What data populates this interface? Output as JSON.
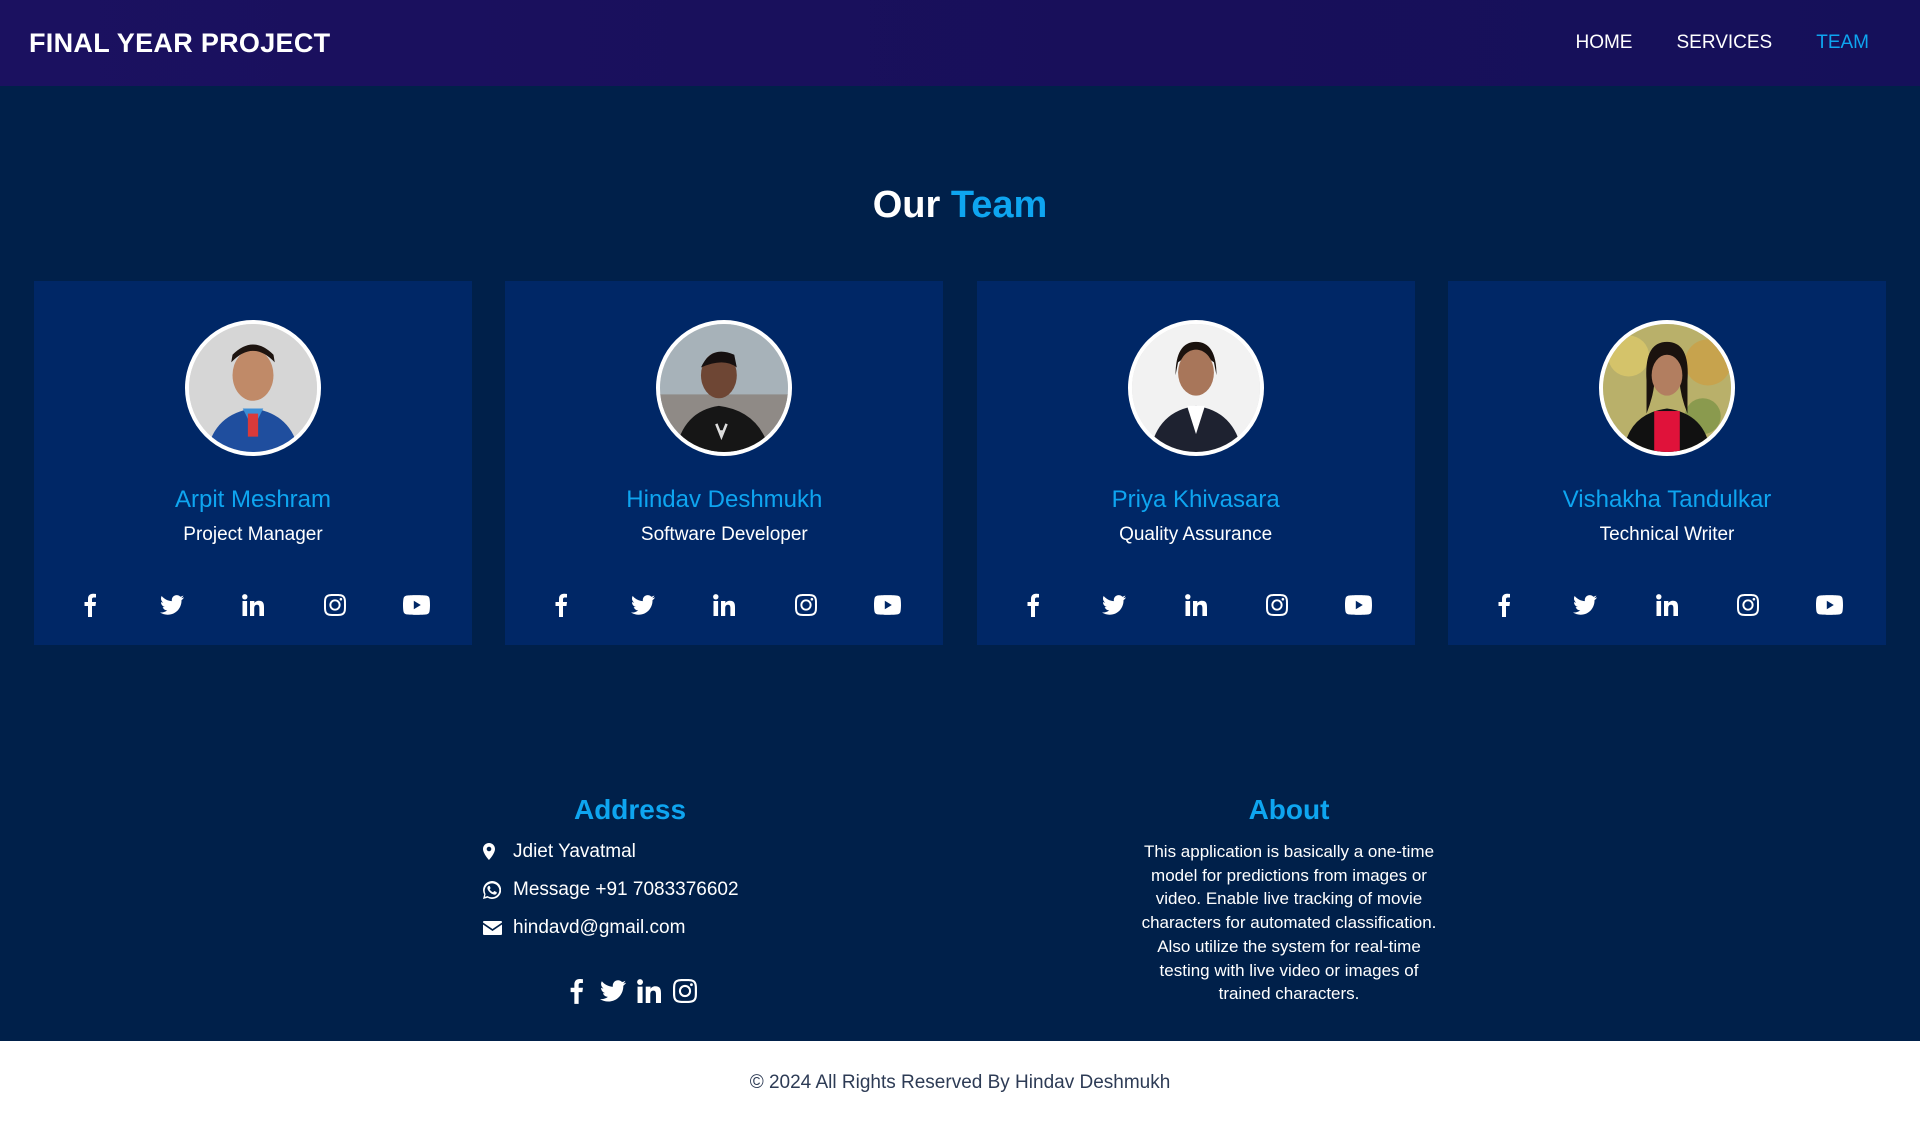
{
  "header": {
    "brand": "FINAL YEAR PROJECT",
    "nav": [
      {
        "label": "HOME"
      },
      {
        "label": "SERVICES"
      },
      {
        "label": "TEAM",
        "active": true
      }
    ]
  },
  "team": {
    "title_prefix": "Our",
    "title_accent": "Team",
    "members": [
      {
        "name": "Arpit Meshram",
        "role": "Project Manager"
      },
      {
        "name": "Hindav Deshmukh",
        "role": "Software Developer"
      },
      {
        "name": "Priya Khivasara",
        "role": "Quality Assurance"
      },
      {
        "name": "Vishakha Tandulkar",
        "role": "Technical Writer"
      }
    ],
    "social_icons": [
      "facebook-icon",
      "twitter-icon",
      "linkedin-icon",
      "instagram-icon",
      "youtube-icon"
    ]
  },
  "footer": {
    "address_heading": "Address",
    "location": "Jdiet Yavatmal",
    "phone": "Message +91 7083376602",
    "email": "hindavd@gmail.com",
    "social_icons": [
      "facebook-icon",
      "twitter-icon",
      "linkedin-icon",
      "instagram-icon"
    ],
    "about_heading": "About",
    "about_text": "This application is basically a one-time model for predictions from images or video. Enable live tracking of movie characters for automated classification. Also utilize the system for real-time testing with live video or images of trained characters.",
    "copyright": "© 2024 All Rights Reserved By Hindav Deshmukh"
  },
  "colors": {
    "accent": "#0ea5f0",
    "page_bg": "#00204a",
    "card_bg": "#002766",
    "header_bg": "#1b1160"
  }
}
